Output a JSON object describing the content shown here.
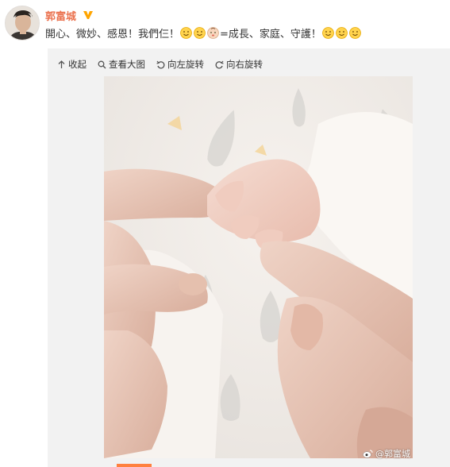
{
  "post": {
    "username": "郭富城",
    "verified_icon": "verified-v-badge",
    "text_part1": "開心、微妙、感恩！我們仨！",
    "text_part2": "=成長、家庭、守護！",
    "emojis_group1": [
      "smile-emoji",
      "smile-emoji",
      "baby-emoji"
    ],
    "emojis_group2": [
      "smile-emoji",
      "smile-emoji",
      "smile-emoji"
    ]
  },
  "toolbar": {
    "collapse_label": "收起",
    "view_large_label": "查看大图",
    "rotate_left_label": "向左旋转",
    "rotate_right_label": "向右旋转"
  },
  "photo": {
    "watermark_text": "@郭富城"
  },
  "colors": {
    "username": "#eb7350",
    "vbadge": "#ffa500",
    "card_bg": "#f2f2f2"
  }
}
